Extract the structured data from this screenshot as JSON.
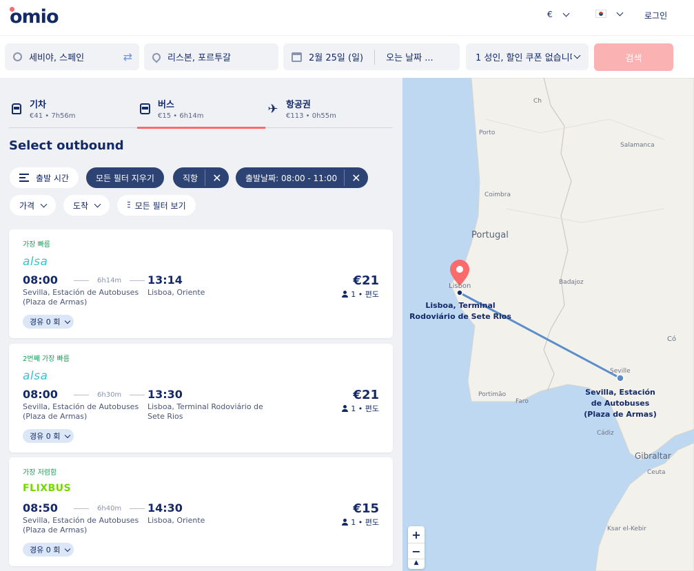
{
  "header": {
    "logo": "omio",
    "currency": "€",
    "login": "로그인"
  },
  "search": {
    "origin": "세비야, 스페인",
    "destination": "리스본, 포르투갈",
    "depart_date": "2월 25일 (일)",
    "return_date": "오는 날짜 ...",
    "passengers": "1 성인, 할인 쿠폰 없습니다",
    "search_button": "검색"
  },
  "modes": [
    {
      "name": "기차",
      "info": "€41 • 7h56m"
    },
    {
      "name": "버스",
      "info": "€15 • 6h14m"
    },
    {
      "name": "항공권",
      "info": "€113 • 0h55m"
    }
  ],
  "title": "Select outbound",
  "filters": {
    "sort": "출발 시간",
    "clear_all": "모든 필터 지우기",
    "direct": "직항",
    "departure_time": "출발날짜: 08:00 - 11:00",
    "price": "가격",
    "arrival": "도착",
    "all_filters": "모든 필터 보기"
  },
  "results": [
    {
      "tag": "가장 빠름",
      "brand": "alsa",
      "dep_time": "08:00",
      "duration": "6h14m",
      "arr_time": "13:14",
      "dep_station": "Sevilla, Estación de Autobuses (Plaza de Armas)",
      "arr_station": "Lisboa, Oriente",
      "price": "€21",
      "pax": "1 • 편도",
      "stops": "경유 0 회"
    },
    {
      "tag": "2번째 가장 빠름",
      "brand": "alsa",
      "dep_time": "08:00",
      "duration": "6h30m",
      "arr_time": "13:30",
      "dep_station": "Sevilla, Estación de Autobuses (Plaza de Armas)",
      "arr_station": "Lisboa, Terminal Rodoviário de Sete Rios",
      "price": "€21",
      "pax": "1 • 편도",
      "stops": "경유 0 회"
    },
    {
      "tag": "가장 저렴함",
      "brand": "FLIXBUS",
      "dep_time": "08:50",
      "duration": "6h40m",
      "arr_time": "14:30",
      "dep_station": "Sevilla, Estación de Autobuses (Plaza de Armas)",
      "arr_station": "Lisboa, Oriente",
      "price": "€15",
      "pax": "1 • 편도",
      "stops": "경유 0 회"
    }
  ],
  "map": {
    "labels": {
      "porto": "Porto",
      "salamanca": "Salamanca",
      "coimbra": "Coimbra",
      "portugal": "Portugal",
      "lisbon": "Lisbon",
      "badajoz": "Badajoz",
      "seville": "Seville",
      "portimao": "Portimão",
      "faro": "Faro",
      "cadiz": "Cádiz",
      "gibraltar": "Gibraltar",
      "ceuta": "Ceuta",
      "ksar": "Ksar el-Kebir",
      "ch": "Ch",
      "co": "Có"
    },
    "lisbon_station": [
      "Lisboa, Terminal",
      "Rodoviário de Sete Rios"
    ],
    "seville_station": [
      "Sevilla, Estación",
      "de Autobuses",
      "(Plaza de Armas)"
    ],
    "zoom_in": "+",
    "zoom_out": "−",
    "compass": "▲"
  },
  "colors": {
    "brand_navy": "#132968",
    "accent_red": "#fa6b6b",
    "search_button": "#fbb2b2",
    "alsa": "#3fc1c9",
    "flixbus": "#73d700",
    "tag_green": "#189b57",
    "route_blue": "#5b8dc9"
  }
}
